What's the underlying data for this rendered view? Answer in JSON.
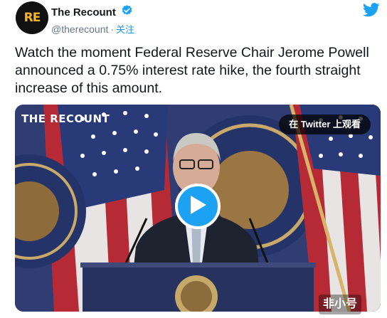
{
  "account": {
    "avatar_text": "RE",
    "display_name": "The Recount",
    "handle": "@therecount",
    "separator": "·",
    "follow_label": "关注"
  },
  "icons": {
    "verified": "verified-badge-icon",
    "brand": "twitter-bird-icon",
    "play": "play-icon"
  },
  "tweet": {
    "text": "Watch the moment Federal Reserve Chair Jerome Powell announced a 0.75% interest rate hike, the fourth straight increase of this amount."
  },
  "media": {
    "watermark": "THE RECOUNT",
    "watch_label": "在 Twitter 上观看"
  },
  "site_watermark": "非小号",
  "colors": {
    "accent": "#1da1f2",
    "link": "#1b95e0",
    "text": "#14171a",
    "secondary": "#657786",
    "avatar_bg": "#111111",
    "avatar_fg": "#f5b623"
  }
}
